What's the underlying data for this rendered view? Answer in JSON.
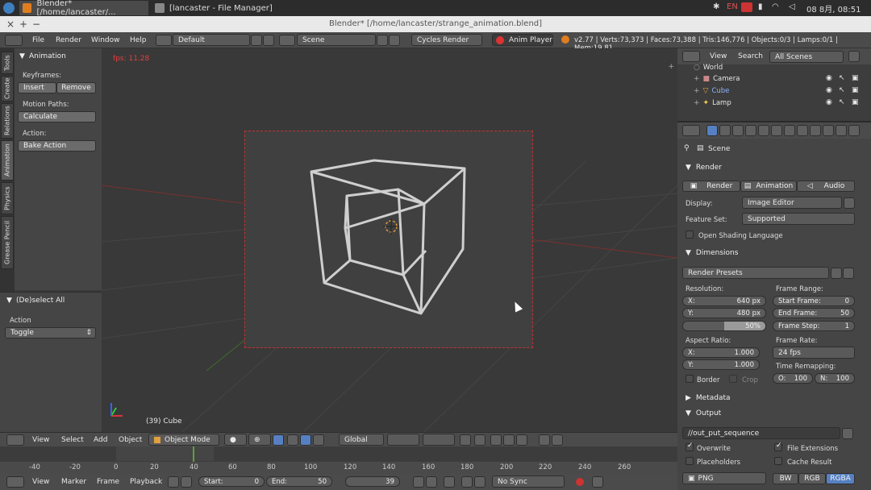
{
  "taskbar": {
    "tasks": [
      {
        "label": "Blender* [/home/lancaster/...",
        "active": true
      },
      {
        "label": "[lancaster - File Manager]",
        "active": false
      }
    ],
    "tray": {
      "lang": "EN",
      "clock": "08 8月, 08:51"
    }
  },
  "window": {
    "title": "Blender* [/home/lancaster/strange_animation.blend]"
  },
  "header": {
    "menus": [
      "File",
      "Render",
      "Window",
      "Help"
    ],
    "layout": "Default",
    "scene": "Scene",
    "engine": "Cycles Render",
    "anim_player": "Anim Player",
    "stats": "v2.77 | Verts:73,373 | Faces:73,388 | Tris:146,776 | Objects:0/3 | Lamps:0/1 | Mem:19.81"
  },
  "tool_tabs": [
    "Tools",
    "Create",
    "Relations",
    "Animation",
    "Physics",
    "Grease Pencil"
  ],
  "tool_shelf": {
    "panel": "Animation",
    "keyframes_label": "Keyframes:",
    "insert": "Insert",
    "remove": "Remove",
    "motion_paths_label": "Motion Paths:",
    "calculate": "Calculate",
    "action_label": "Action:",
    "bake_action": "Bake Action"
  },
  "redo_panel": {
    "title": "(De)select All",
    "action_label": "Action",
    "action_value": "Toggle"
  },
  "viewport": {
    "fps": "fps: 11.28",
    "object_label": "(39) Cube"
  },
  "view3d_header": {
    "menus": [
      "View",
      "Select",
      "Add",
      "Object"
    ],
    "mode": "Object Mode",
    "orientation": "Global"
  },
  "timeline": {
    "ticks": [
      "-40",
      "-20",
      "0",
      "20",
      "40",
      "60",
      "80",
      "100",
      "120",
      "140",
      "160",
      "180",
      "200",
      "220",
      "240",
      "260"
    ],
    "menus": [
      "View",
      "Marker",
      "Frame",
      "Playback"
    ],
    "start": "Start:",
    "start_val": "0",
    "end": "End:",
    "end_val": "50",
    "current": "39",
    "sync": "No Sync"
  },
  "outliner": {
    "menus": [
      "View",
      "Search"
    ],
    "filter": "All Scenes",
    "items": [
      "World",
      "Camera",
      "Cube",
      "Lamp"
    ]
  },
  "properties": {
    "context": "Scene",
    "render": {
      "title": "Render",
      "buttons": [
        "Render",
        "Animation",
        "Audio"
      ],
      "display_label": "Display:",
      "display_value": "Image Editor",
      "feature_label": "Feature Set:",
      "feature_value": "Supported",
      "osl": "Open Shading Language"
    },
    "dimensions": {
      "title": "Dimensions",
      "presets": "Render Presets",
      "resolution_label": "Resolution:",
      "x_label": "X:",
      "x_value": "640 px",
      "y_label": "Y:",
      "y_value": "480 px",
      "percent": "50%",
      "frame_range_label": "Frame Range:",
      "start_label": "Start Frame:",
      "start_value": "0",
      "end_label": "End Frame:",
      "end_value": "50",
      "step_label": "Frame Step:",
      "step_value": "1",
      "aspect_label": "Aspect Ratio:",
      "ax_label": "X:",
      "ax_value": "1.000",
      "ay_label": "Y:",
      "ay_value": "1.000",
      "frame_rate_label": "Frame Rate:",
      "frame_rate_value": "24 fps",
      "border": "Border",
      "crop": "Crop",
      "time_remap_label": "Time Remapping:",
      "o_label": "O:",
      "o_value": "100",
      "n_label": "N:",
      "n_value": "100"
    },
    "metadata": {
      "title": "Metadata"
    },
    "output": {
      "title": "Output",
      "path": "//out_put_sequence",
      "overwrite": "Overwrite",
      "file_ext": "File Extensions",
      "placeholders": "Placeholders",
      "cache_result": "Cache Result",
      "format": "PNG",
      "color_modes": [
        "BW",
        "RGB",
        "RGBA"
      ]
    }
  },
  "colors": {
    "accent": "#5680c2",
    "selection_red": "#c03030",
    "panel": "#454545",
    "viewport": "#393939"
  }
}
